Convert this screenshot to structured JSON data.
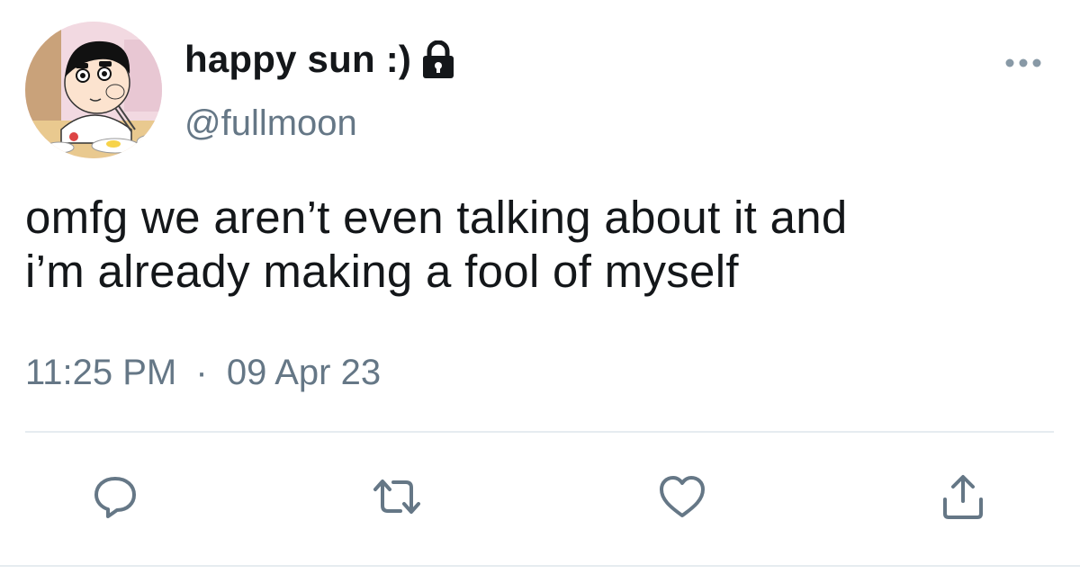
{
  "tweet": {
    "display_name": "happy sun :)",
    "handle": "@fullmoon",
    "text_line1": "omfg we aren’t even talking about it and",
    "text_line2": "i’m already making a fool of myself",
    "time": "11:25 PM",
    "separator": "·",
    "date": "09 Apr 23"
  },
  "icons": {
    "lock": "lock-icon",
    "more": "more-icon",
    "reply": "reply-icon",
    "retweet": "retweet-icon",
    "like": "heart-icon",
    "share": "share-icon"
  },
  "colors": {
    "text": "#14171a",
    "secondary": "#657786",
    "divider": "#e6ecf0",
    "action_icon": "#657786"
  }
}
